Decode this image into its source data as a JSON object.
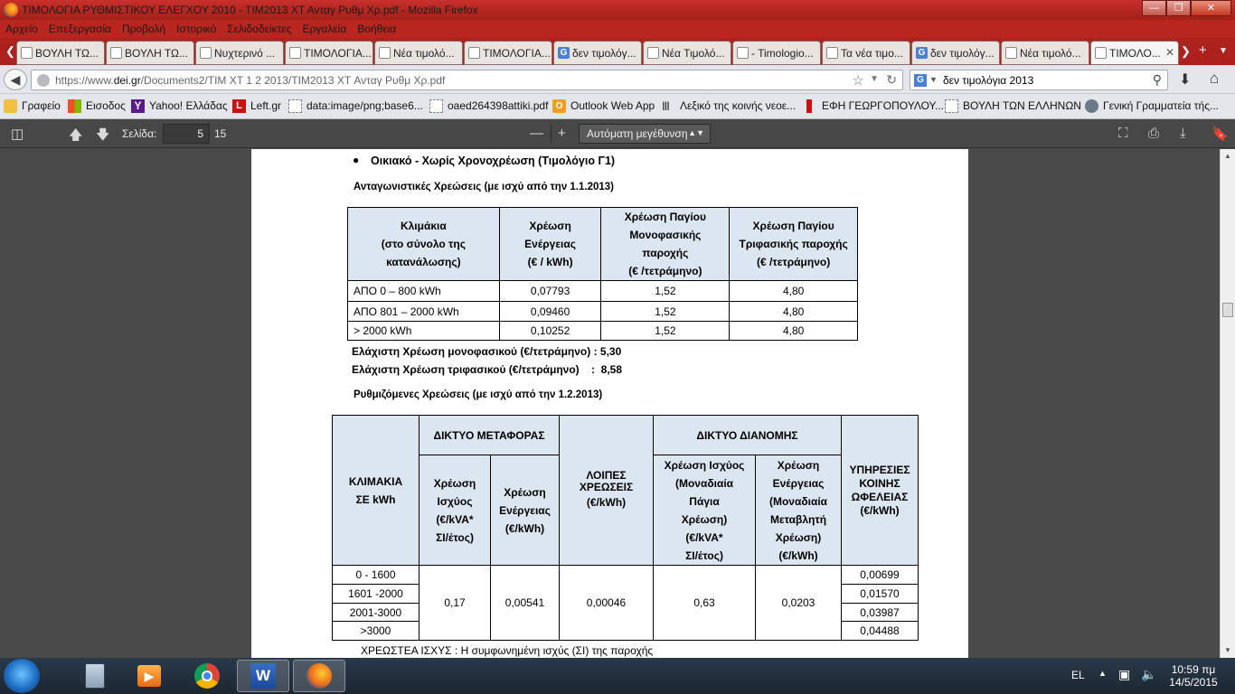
{
  "window": {
    "title": "ΤΙΜΟΛΟΓΙΑ ΡΥΘΜΙΣΤΙΚΟΥ ΕΛΕΓΧΟΥ 2010 - ΤΙΜ2013 ΧΤ Ανταγ Ρυθμ Χρ.pdf - Mozilla Firefox",
    "controls": {
      "minimize": "—",
      "maximize": "❐",
      "close": "✕"
    }
  },
  "menu": [
    "Αρχείο",
    "Επεξεργασία",
    "Προβολή",
    "Ιστορικό",
    "Σελιδοδείκτες",
    "Εργαλεία",
    "Βοήθεια"
  ],
  "tabs": [
    {
      "label": "ΒΟΥΛΗ ΤΩ...",
      "icon": "page-icon"
    },
    {
      "label": "ΒΟΥΛΗ ΤΩ...",
      "icon": "page-icon"
    },
    {
      "label": "Νυχτερινό ...",
      "icon": "page-icon"
    },
    {
      "label": "ΤΙΜΟΛΟΓΙΑ...",
      "icon": "page-icon"
    },
    {
      "label": "Νέα τιμολό...",
      "icon": "page-icon"
    },
    {
      "label": "ΤΙΜΟΛΟΓΙΑ...",
      "icon": "page-icon"
    },
    {
      "label": "δεν τιμολόγ...",
      "icon": "google-icon"
    },
    {
      "label": "Νέα Τιμολό...",
      "icon": "page-icon"
    },
    {
      "label": "- Timologio...",
      "icon": "page-icon"
    },
    {
      "label": "Τα νέα τιμο...",
      "icon": "page-icon"
    },
    {
      "label": "δεν τιμολόγ...",
      "icon": "google-icon"
    },
    {
      "label": "Νέα τιμολό...",
      "icon": "page-icon"
    },
    {
      "label": "ΤΙΜΟΛΟ...",
      "icon": "page-icon"
    }
  ],
  "nav": {
    "url_prefix": "https://www.",
    "url_domain": "dei.gr",
    "url_path": "/Documents2/TIM XT 1 2 2013/TIM2013 XT Ανταγ  Ρυθμ Χρ.pdf",
    "search_query": "δεν τιμολόγια 2013",
    "search_engine": "G"
  },
  "bookmarks": [
    {
      "label": "Γραφείο",
      "color": "#f0c040"
    },
    {
      "label": "Εισοδος",
      "color": "#3a8ee0"
    },
    {
      "label": "Yahoo! Ελλάδας",
      "color": "#5a1a8a"
    },
    {
      "label": "Left.gr",
      "color": "#cc1111"
    },
    {
      "label": "data:image/png;base6...",
      "color": "#ffffff"
    },
    {
      "label": "oaed264398attiki.pdf",
      "color": "#ffffff"
    },
    {
      "label": "Outlook Web App",
      "color": "#f0a020"
    },
    {
      "label": "Λεξικό της κοινής νεοε...",
      "color": "#333333"
    },
    {
      "label": "ΕΦΗ ΓΕΩΡΓΟΠΟΥΛΟΥ...",
      "color": "#cc1111"
    },
    {
      "label": "ΒΟΥΛΗ ΤΩΝ ΕΛΛΗΝΩΝ",
      "color": "#ffffff"
    },
    {
      "label": "Γενική Γραμματεία τής...",
      "color": "#6a7a8a"
    }
  ],
  "pdf_toolbar": {
    "page_label": "Σελίδα:",
    "page_current": "5",
    "page_total": "15",
    "zoom": "Αυτόματη μεγέθυνση"
  },
  "doc": {
    "bullet_line": "Οικιακό  -  Χωρίς Χρονοχρέωση (Τιμολόγιο Γ1)",
    "section1_title": "Ανταγωνιστικές Χρεώσεις  (με ισχύ από την 1.1.2013)",
    "table1": {
      "headers": [
        [
          "Κλιμάκια",
          "(στο σύνολο της",
          "κατανάλωσης)"
        ],
        [
          "Χρέωση",
          "Ενέργειας",
          "(€ / kWh)"
        ],
        [
          "Χρέωση Παγίου",
          "Μονοφασικής",
          "παροχής",
          "(€ /τετράμηνο)"
        ],
        [
          "Χρέωση Παγίου",
          "Τριφασικής παροχής",
          "(€ /τετράμηνο)"
        ]
      ],
      "rows": [
        [
          "ΑΠΟ 0 – 800 kWh",
          "0,07793",
          "1,52",
          "4,80"
        ],
        [
          "ΑΠΟ 801 – 2000 kWh",
          "0,09460",
          "1,52",
          "4,80"
        ],
        [
          ">  2000 kWh",
          "0,10252",
          "1,52",
          "4,80"
        ]
      ]
    },
    "min_single": "Ελάχιστη Χρέωση μονοφασικού (€/τετράμηνο) : 5,30",
    "min_three": "Ελάχιστη Χρέωση τριφασικού (€/τετράμηνο)    :  8,58",
    "section2_title": "Ρυθμιζόμενες  Χρεώσεις  (με ισχύ από την 1.2.2013)",
    "table2": {
      "col_klimakia": [
        "ΚΛΙΜΑΚΙΑ",
        "ΣΕ  kWh"
      ],
      "group_metaforas": "ΔΙΚΤΥΟ ΜΕΤΑΦΟΡΑΣ",
      "group_dianomis": "ΔΙΚΤΥΟ ΔΙΑΝΟΜΗΣ",
      "col_m_isxyos": [
        "Χρέωση",
        "Ισχύος",
        "(€/kVA*",
        "ΣΙ/έτος)"
      ],
      "col_m_energeias": [
        "Χρέωση",
        "Ενέργειας",
        "(€/kWh)"
      ],
      "col_loipes": [
        "ΛΟΙΠΕΣ",
        "ΧΡΕΩΣΕΙΣ",
        "(€/kWh)"
      ],
      "col_d_isxyos": [
        "Χρέωση Ισχύος",
        "(Μοναδιαία",
        "Πάγια",
        "Χρέωση)",
        "(€/kVA*",
        "ΣΙ/έτος)"
      ],
      "col_d_energeias": [
        "Χρέωση",
        "Ενέργειας",
        "(Μοναδιαία",
        "Μεταβλητή",
        "Χρέωση)",
        "(€/kWh)"
      ],
      "col_ypk": [
        "ΥΠΗΡΕΣΙΕΣ",
        "ΚΟΙΝΗΣ",
        "ΩΦΕΛΕΙΑΣ",
        "(€/kWh)"
      ],
      "klimakia": [
        "0 - 1600",
        "1601 -2000",
        "2001-3000",
        ">3000"
      ],
      "m_isxyos": "0,17",
      "m_energeias": "0,00541",
      "loipes": "0,00046",
      "d_isxyos": "0,63",
      "d_energeias": "0,0203",
      "ypk": [
        "0,00699",
        "0,01570",
        "0,03987",
        "0,04488"
      ]
    },
    "footnote": "ΧΡΕΩΣΤΕΑ ΙΣΧΥΣ :  Η συμφωνημένη ισχύς (ΣΙ) της παροχής"
  },
  "taskbar": {
    "lang": "EL",
    "time": "10:59 πμ",
    "date": "14/5/2015"
  }
}
